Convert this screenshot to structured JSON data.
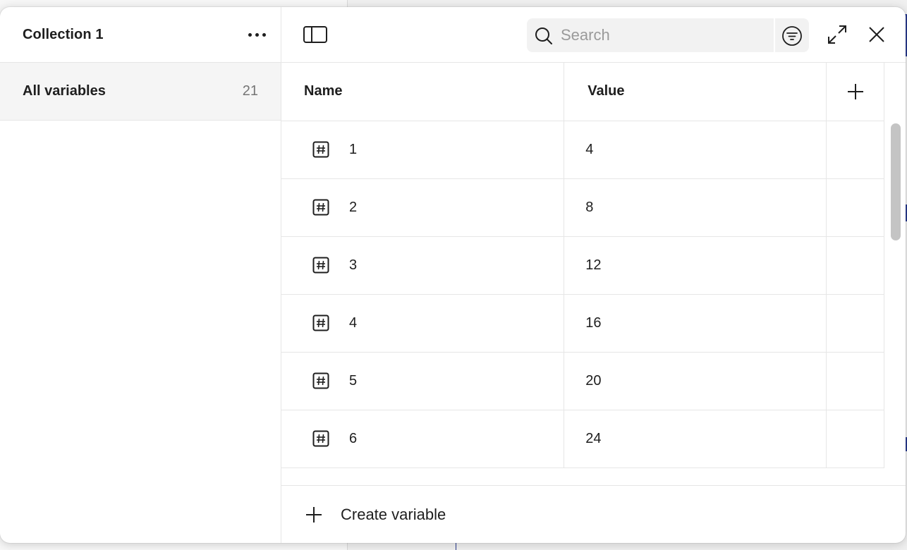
{
  "sidebar": {
    "collection_title": "Collection 1",
    "more_icon": "more-horizontal-icon",
    "items": [
      {
        "label": "All variables",
        "count": "21"
      }
    ]
  },
  "toolbar": {
    "sidebar_toggle_icon": "sidebar-toggle-icon",
    "search": {
      "placeholder": "Search",
      "value": ""
    },
    "filter_icon": "filter-icon",
    "expand_icon": "expand-icon",
    "close_icon": "close-icon"
  },
  "table": {
    "columns": {
      "name": "Name",
      "value": "Value"
    },
    "add_column_icon": "plus-icon",
    "rows": [
      {
        "name": "1",
        "value": "4"
      },
      {
        "name": "2",
        "value": "8"
      },
      {
        "name": "3",
        "value": "12"
      },
      {
        "name": "4",
        "value": "16"
      },
      {
        "name": "5",
        "value": "20"
      },
      {
        "name": "6",
        "value": "24"
      }
    ]
  },
  "footer": {
    "create_label": "Create variable"
  },
  "colors": {
    "sidebar_selected_bg": "#f5f5f5",
    "border": "#e6e6e6",
    "text": "#1e1e1e",
    "muted": "#757575",
    "scrollbar": "#c4c4c4"
  }
}
